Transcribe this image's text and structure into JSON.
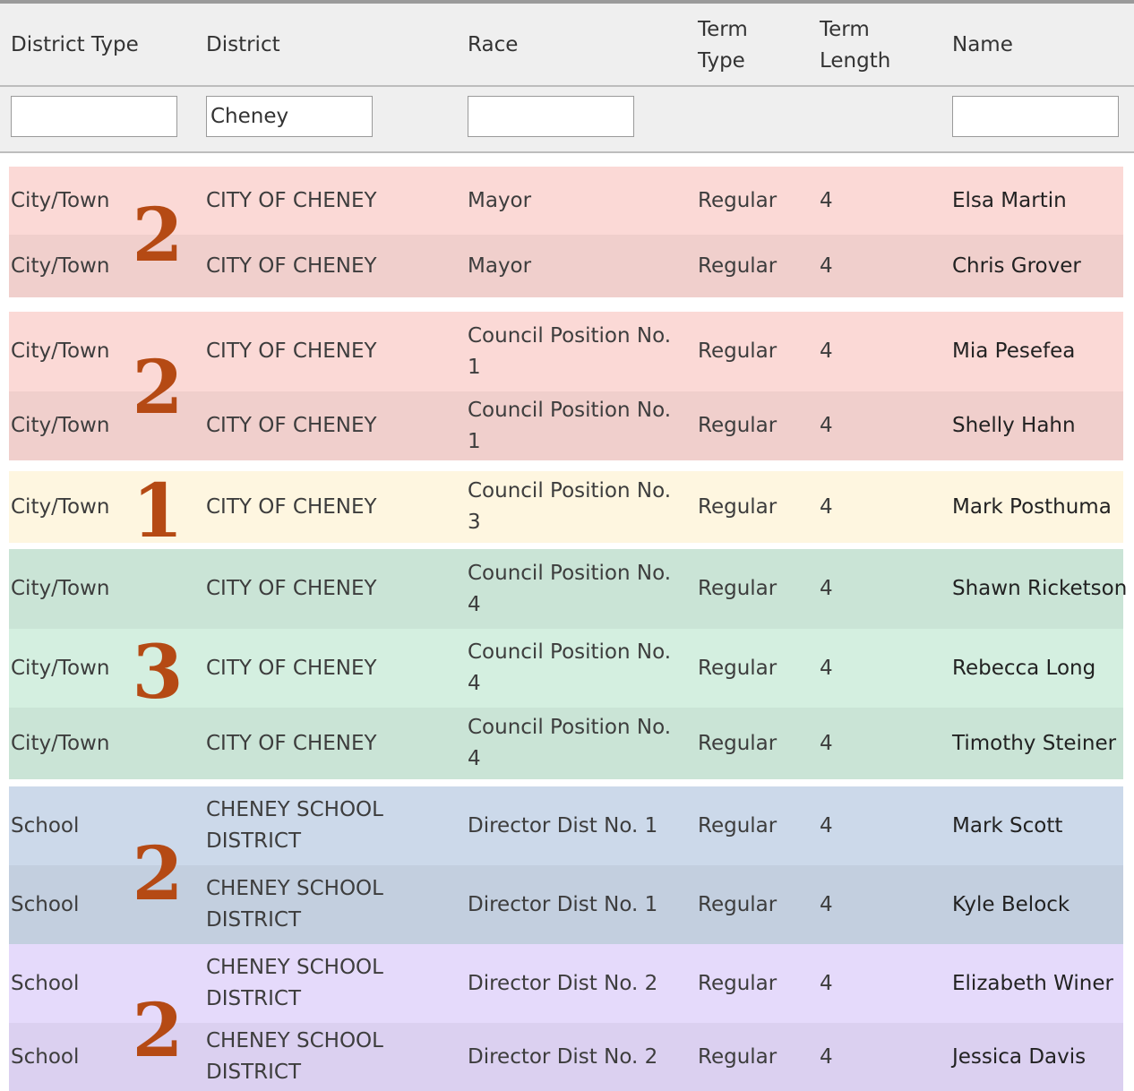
{
  "columns": {
    "district_type": "District Type",
    "district": "District",
    "race": "Race",
    "term_type": "Term Type",
    "term_length": "Term Length",
    "name": "Name"
  },
  "filters": {
    "district_type": "",
    "district": "Cheney",
    "race": "",
    "name": ""
  },
  "colors": {
    "red": "#fbd9d6",
    "yellow": "#fef6e0",
    "green": "#d4efe0",
    "blue": "#ccd9ea",
    "purple": "#e5dafb",
    "badge": "#b54a14"
  },
  "rows": [
    {
      "district_type": "City/Town",
      "district": "CITY OF CHENEY",
      "race": "Mayor",
      "term_type": "Regular",
      "term_length": "4",
      "name": "Elsa Martin"
    },
    {
      "district_type": "City/Town",
      "district": "CITY OF CHENEY",
      "race": "Mayor",
      "term_type": "Regular",
      "term_length": "4",
      "name": "Chris Grover"
    },
    {
      "district_type": "City/Town",
      "district": "CITY OF CHENEY",
      "race": "Council Position No. 1",
      "term_type": "Regular",
      "term_length": "4",
      "name": "Mia Pesefea"
    },
    {
      "district_type": "City/Town",
      "district": "CITY OF CHENEY",
      "race": "Council Position No. 1",
      "term_type": "Regular",
      "term_length": "4",
      "name": "Shelly Hahn"
    },
    {
      "district_type": "City/Town",
      "district": "CITY OF CHENEY",
      "race": "Council Position No. 3",
      "term_type": "Regular",
      "term_length": "4",
      "name": "Mark Posthuma"
    },
    {
      "district_type": "City/Town",
      "district": "CITY OF CHENEY",
      "race": "Council Position No. 4",
      "term_type": "Regular",
      "term_length": "4",
      "name": "Shawn Ricketson"
    },
    {
      "district_type": "City/Town",
      "district": "CITY OF CHENEY",
      "race": "Council Position No. 4",
      "term_type": "Regular",
      "term_length": "4",
      "name": "Rebecca Long"
    },
    {
      "district_type": "City/Town",
      "district": "CITY OF CHENEY",
      "race": "Council Position No. 4",
      "term_type": "Regular",
      "term_length": "4",
      "name": "Timothy Steiner"
    },
    {
      "district_type": "School",
      "district": "CHENEY SCHOOL DISTRICT",
      "race": "Director Dist No. 1",
      "term_type": "Regular",
      "term_length": "4",
      "name": "Mark Scott"
    },
    {
      "district_type": "School",
      "district": "CHENEY SCHOOL DISTRICT",
      "race": "Director Dist No. 1",
      "term_type": "Regular",
      "term_length": "4",
      "name": "Kyle Belock"
    },
    {
      "district_type": "School",
      "district": "CHENEY SCHOOL DISTRICT",
      "race": "Director Dist No. 2",
      "term_type": "Regular",
      "term_length": "4",
      "name": "Elizabeth Winer"
    },
    {
      "district_type": "School",
      "district": "CHENEY SCHOOL DISTRICT",
      "race": "Director Dist No. 2",
      "term_type": "Regular",
      "term_length": "4",
      "name": "Jessica Davis"
    }
  ],
  "groups": [
    {
      "count": "2",
      "color": "red"
    },
    {
      "count": "2",
      "color": "red"
    },
    {
      "count": "1",
      "color": "yellow"
    },
    {
      "count": "3",
      "color": "green"
    },
    {
      "count": "2",
      "color": "blue"
    },
    {
      "count": "2",
      "color": "purple"
    }
  ]
}
